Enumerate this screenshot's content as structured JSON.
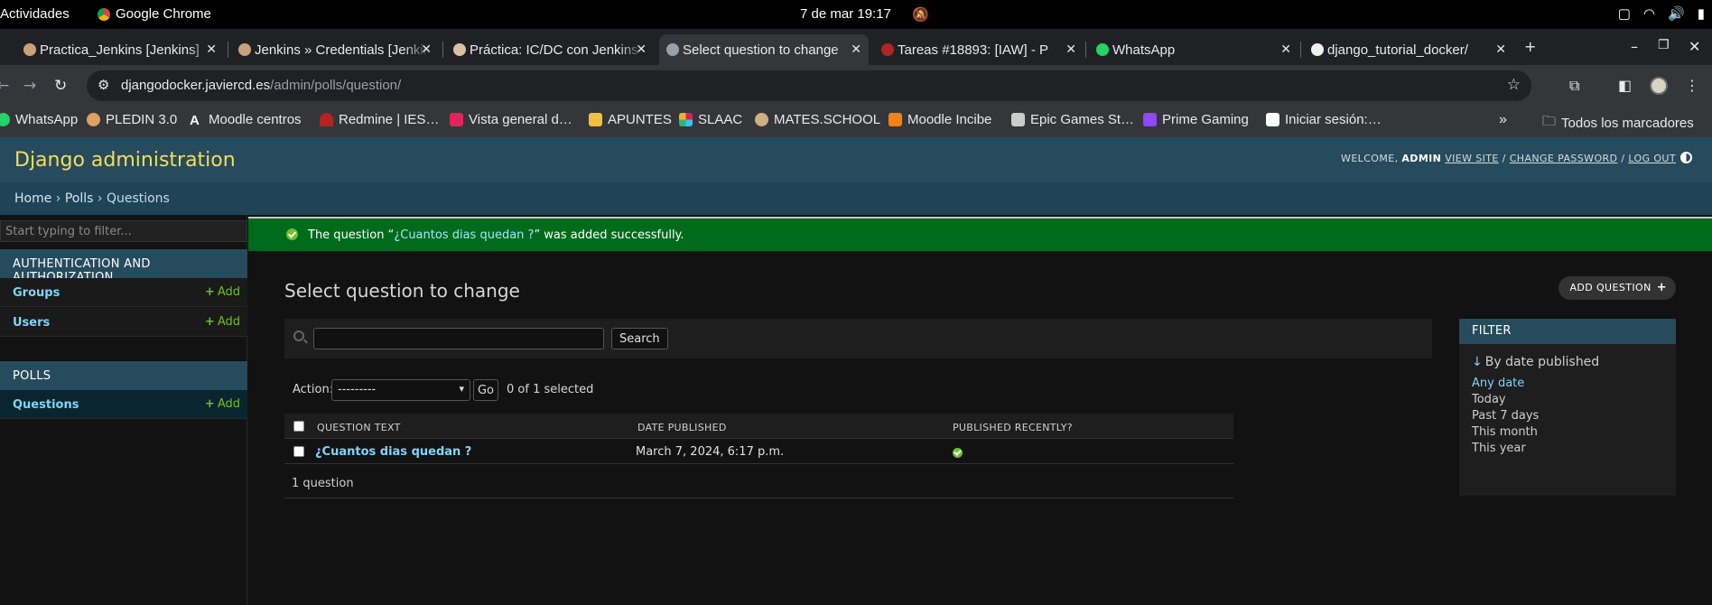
{
  "system_bar": {
    "activities": "Actividades",
    "app_name": "Google Chrome",
    "clock": "7 de mar  19:17"
  },
  "tabs": [
    {
      "label": "Practica_Jenkins [Jenkins]"
    },
    {
      "label": "Jenkins » Credentials [Jenkins]"
    },
    {
      "label": "Práctica: IC/DC con Jenkins"
    },
    {
      "label": "Select question to change"
    },
    {
      "label": "Tareas #18893: [IAW] - P"
    },
    {
      "label": "WhatsApp"
    },
    {
      "label": "django_tutorial_docker/"
    }
  ],
  "toolbar": {
    "url_host": "djangodocker.javiercd.es",
    "url_path": "/admin/polls/question/"
  },
  "bookmarks": [
    {
      "label": "WhatsApp",
      "color": "#25d366"
    },
    {
      "label": "PLEDIN 3.0",
      "color": "#e0a060"
    },
    {
      "label": "Moodle centros",
      "color": "#ffffff"
    },
    {
      "label": "Redmine | IES…",
      "color": "#b32424"
    },
    {
      "label": "Vista general d…",
      "color": "#e0245e"
    },
    {
      "label": "APUNTES",
      "color": "#f0c040"
    },
    {
      "label": "SLAAC",
      "color": "#e01e5a"
    },
    {
      "label": "MATES.SCHOOL",
      "color": "#d0b080"
    },
    {
      "label": "Moodle Incibe",
      "color": "#f98012"
    },
    {
      "label": "Epic Games St…",
      "color": "#cccccc"
    },
    {
      "label": "Prime Gaming",
      "color": "#9146ff"
    },
    {
      "label": "Iniciar sesión:…",
      "color": "#ffffff"
    }
  ],
  "bookmarks_all": "Todos los marcadores",
  "admin": {
    "branding": "Django administration",
    "welcome": "WELCOME,",
    "user": "ADMIN",
    "view_site": "VIEW SITE",
    "change_password": "CHANGE PASSWORD",
    "logout": "LOG OUT",
    "breadcrumbs": {
      "home": "Home",
      "app": "Polls",
      "model": "Questions"
    },
    "filter_placeholder": "Start typing to filter...",
    "nav": {
      "auth_caption": "AUTHENTICATION AND AUTHORIZATION",
      "groups": "Groups",
      "users": "Users",
      "polls_caption": "POLLS",
      "questions": "Questions",
      "add": "Add"
    },
    "message": {
      "prefix": "The question “",
      "link": "¿Cuantos dias quedan ?",
      "suffix": "” was added successfully."
    },
    "title": "Select question to change",
    "add_button": "ADD QUESTION",
    "search_button": "Search",
    "action_label": "Action:",
    "action_select": "---------",
    "go": "Go",
    "selected_count": "0 of 1 selected",
    "columns": {
      "question_text": "QUESTION TEXT",
      "date_published": "DATE PUBLISHED",
      "published_recently": "PUBLISHED RECENTLY?"
    },
    "rows": [
      {
        "question": "¿Cuantos dias quedan ?",
        "date": "March 7, 2024, 6:17 p.m.",
        "recent": true
      }
    ],
    "paginator": "1 question",
    "filter": {
      "title": "FILTER",
      "by": "By date published",
      "options": [
        "Any date",
        "Today",
        "Past 7 days",
        "This month",
        "This year"
      ],
      "selected": "Any date"
    }
  }
}
